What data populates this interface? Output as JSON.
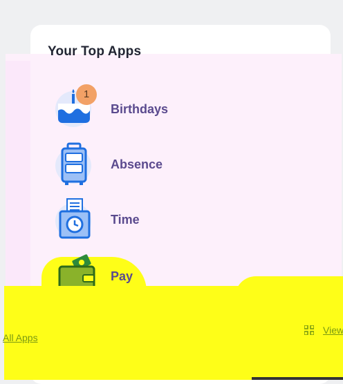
{
  "card": {
    "title": "Your Top Apps"
  },
  "apps": [
    {
      "label": "Birthdays",
      "icon": "birthday-cake-icon",
      "badge": "1"
    },
    {
      "label": "Absence",
      "icon": "suitcase-icon"
    },
    {
      "label": "Time",
      "icon": "time-clock-icon"
    },
    {
      "label": "Pay",
      "icon": "wallet-icon"
    }
  ],
  "footer": {
    "all_apps_label": "All Apps",
    "view_label": "View"
  },
  "colors": {
    "accent": "#5a4a8e",
    "badge": "#f2a166",
    "highlight_yellow": "#fefe18",
    "link_green": "#7a9a12"
  }
}
